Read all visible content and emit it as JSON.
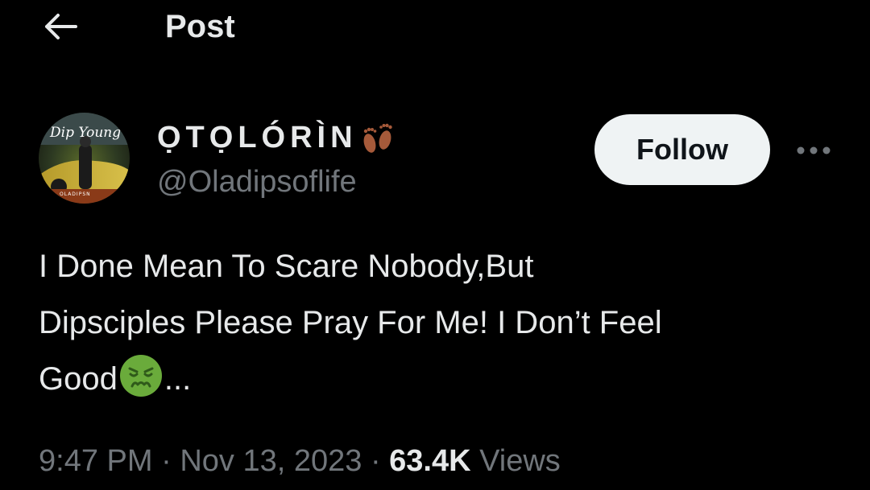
{
  "header": {
    "title": "Post",
    "back_icon": "arrow-left-icon"
  },
  "author": {
    "display_name": "ỌTỌLÓRÌN",
    "display_name_emoji": "footprints-icon",
    "handle": "@Oladipsoflife",
    "avatar_text": "Dip Young",
    "avatar_subtext": "OLADIPSN",
    "follow_label": "Follow",
    "more_icon": "more-horizontal-icon"
  },
  "tweet": {
    "line1": "I Done Mean To Scare Nobody,But",
    "line2": "Dipsciples Please Pray For Me! I Don’t Feel",
    "line3_text": "Good",
    "line3_emoji": "nauseated-face-icon",
    "line3_suffix": "..."
  },
  "meta": {
    "time": "9:47 PM",
    "separator": "·",
    "date": "Nov 13, 2023",
    "views_count": "63.4K",
    "views_label": "Views"
  },
  "colors": {
    "background": "#000000",
    "primary_text": "#e7e9ea",
    "secondary_text": "#71767b",
    "follow_bg": "#eff3f4",
    "follow_text": "#0f1419",
    "emoji_green": "#6aab3b"
  }
}
